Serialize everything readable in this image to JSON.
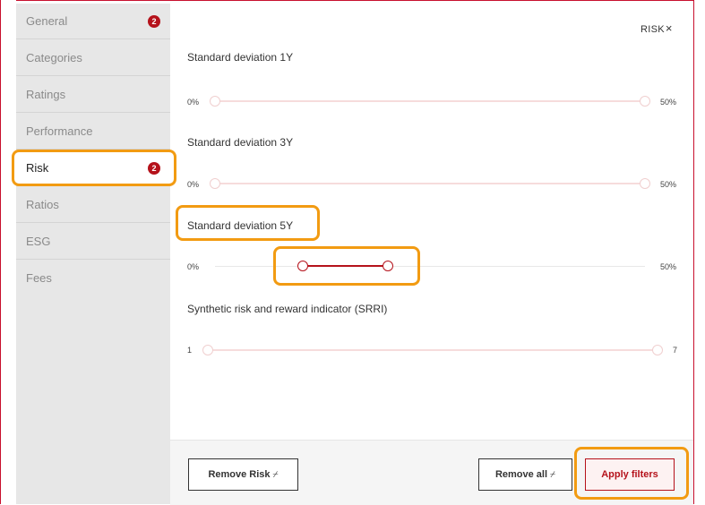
{
  "sidebar": {
    "items": [
      {
        "label": "General",
        "badge": "2"
      },
      {
        "label": "Categories"
      },
      {
        "label": "Ratings"
      },
      {
        "label": "Performance"
      },
      {
        "label": "Risk",
        "badge": "2",
        "active": true
      },
      {
        "label": "Ratios"
      },
      {
        "label": "ESG"
      },
      {
        "label": "Fees"
      }
    ]
  },
  "panel": {
    "close_label": "RISK",
    "close_icon": "×",
    "filters": [
      {
        "title": "Standard deviation 1Y",
        "min_label": "0%",
        "max_label": "50%",
        "selected": [
          0,
          1
        ]
      },
      {
        "title": "Standard deviation 3Y",
        "min_label": "0%",
        "max_label": "50%",
        "selected": [
          0,
          1
        ]
      },
      {
        "title": "Standard deviation 5Y",
        "min_label": "0%",
        "max_label": "50%",
        "selected": [
          0.2,
          0.41
        ]
      },
      {
        "title": "Synthetic risk and reward indicator (SRRI)",
        "min_label": "1",
        "max_label": "7",
        "selected": [
          0,
          1
        ]
      }
    ]
  },
  "footer": {
    "remove_risk_label": "Remove Risk",
    "remove_all_label": "Remove all",
    "apply_label": "Apply filters",
    "broom_icon": "broom-icon"
  },
  "colors": {
    "accent": "#b5121b",
    "highlight": "#f29b12",
    "sidebar_bg": "#e7e7e7"
  }
}
